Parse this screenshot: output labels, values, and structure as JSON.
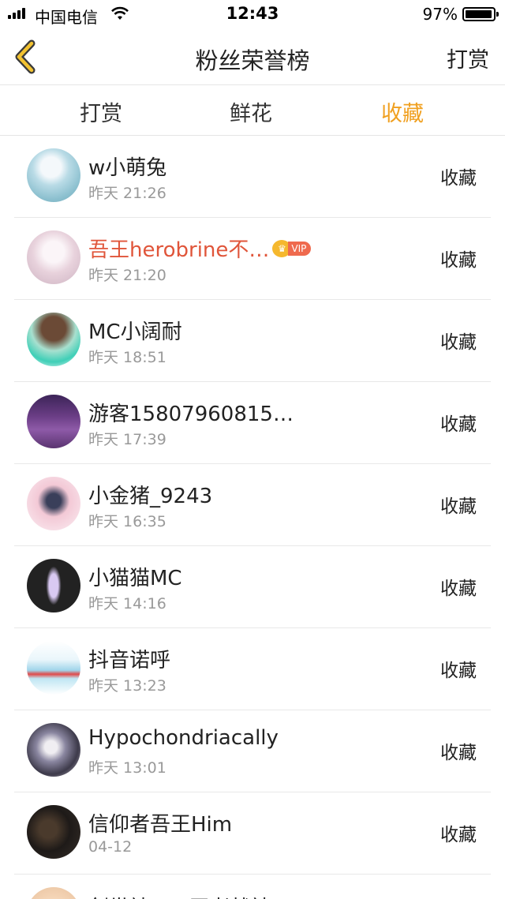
{
  "status_bar": {
    "carrier": "中国电信",
    "time": "12:43",
    "battery": "97%",
    "battery_level": 0.97
  },
  "nav": {
    "title": "粉丝荣誉榜",
    "right_action": "打赏"
  },
  "tabs": [
    {
      "label": "打赏",
      "active": false
    },
    {
      "label": "鲜花",
      "active": false
    },
    {
      "label": "收藏",
      "active": true
    }
  ],
  "accent_color": "#f0a020",
  "highlight_name_color": "#e0553a",
  "rows": [
    {
      "name": "w小萌兔",
      "time": "昨天 21:26",
      "action": "收藏"
    },
    {
      "name": "吾王herobrine不…",
      "time": "昨天 21:20",
      "action": "收藏",
      "vip": "VIP",
      "crown": "♛"
    },
    {
      "name": "MC小阔耐",
      "time": "昨天 18:51",
      "action": "收藏"
    },
    {
      "name": "游客15807960815…",
      "time": "昨天 17:39",
      "action": "收藏"
    },
    {
      "name": "小金猪_9243",
      "time": "昨天 16:35",
      "action": "收藏"
    },
    {
      "name": "小猫猫MC",
      "time": "昨天 14:16",
      "action": "收藏"
    },
    {
      "name": "抖音诺呼",
      "time": "昨天 13:23",
      "action": "收藏"
    },
    {
      "name": "Hypochondriacally",
      "time": "昨天 13:01",
      "action": "收藏"
    },
    {
      "name": "信仰者吾王Him",
      "time": "04-12",
      "action": "收藏"
    }
  ],
  "partial_row": {
    "name": "剑世神HIM王者战神"
  }
}
